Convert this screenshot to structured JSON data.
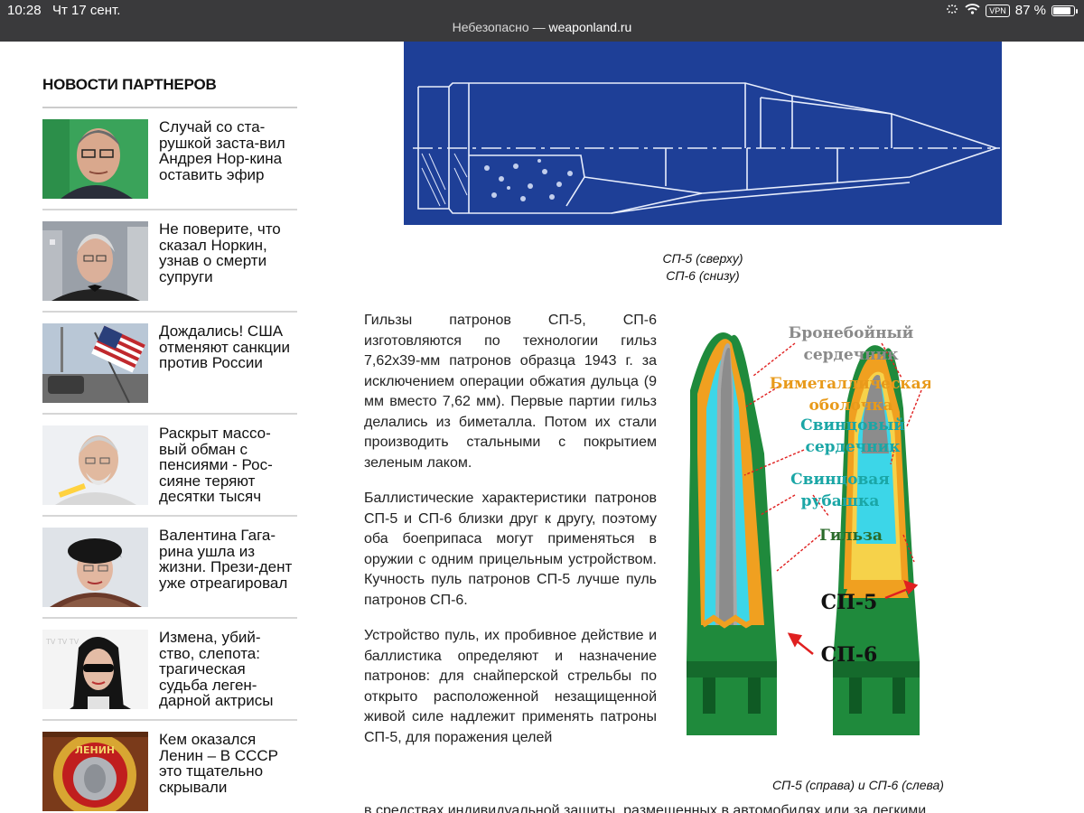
{
  "status_bar": {
    "time": "10:28",
    "date": "Чт 17 сент.",
    "vpn": "VPN",
    "battery": "87 %",
    "battery_level": 0.87
  },
  "url_bar": {
    "prefix": "Небезопасно — ",
    "host": "weaponland.ru"
  },
  "sidebar": {
    "heading": "НОВОСТИ ПАРТНЕРОВ",
    "items": [
      {
        "text": "Случай со ста-рушкой заста-вил Андрея Нор-кина оставить эфир"
      },
      {
        "text": "Не поверите, что сказал Норкин, узнав о смерти супруги"
      },
      {
        "text": "Дождались! США отменяют санкции против России"
      },
      {
        "text": "Раскрыт массо-вый обман с пенсиями - Рос-сияне теряют десятки тысяч"
      },
      {
        "text": "Валентина Гага-рина ушла из жизни. Прези-дент уже отреагировал"
      },
      {
        "text": "Измена, убий-ство, слепота: трагическая судьба леген-дарной актрисы"
      },
      {
        "text": "Кем оказался Ленин – В СССР это тщательно скрывали"
      }
    ],
    "medal_text": "ЛЕНИН"
  },
  "article": {
    "figure1_caption_line1": "СП-5 (сверху)",
    "figure1_caption_line2": "СП-6 (снизу)",
    "paragraphs": [
      "Гильзы патронов СП-5, СП-6 изготовляются по технологии гильз 7,62х39-мм патронов образца 1943 г. за исключением операции обжатия дульца (9 мм вместо 7,62 мм). Первые партии гильз делались из биметалла. Потом их стали производить стальными с покрытием зеленым лаком.",
      "Баллистические характеристики патронов СП-5 и СП-6 близки друг к другу, поэтому оба боеприпаса могут применяться в оружии с одним прицельным устройством. Кучность пуль патронов СП-5 лучше пуль патронов СП-6.",
      "Устройство пуль, их пробивное действие и баллистика определяют и назначение патронов: для снайперской стрельбы по открыто расположенной незащищенной живой силе надлежит применять патроны СП-5, для поражения целей"
    ],
    "overflow_line": "в средствах индивидуальной защиты, размещенных в автомобилях или за легкими",
    "figure2": {
      "labels": {
        "armor_core": [
          "Бронебойный",
          "сердечник"
        ],
        "bimetal_jacket": [
          "Биметаллическая",
          "оболочка"
        ],
        "lead_core": [
          "Свинцовый",
          "сердечник"
        ],
        "lead_jacket": [
          "Свинцовая",
          "рубашка"
        ],
        "case": "Гильза",
        "sp5": "СП-5",
        "sp6": "СП-6"
      },
      "colors": {
        "case_green": "#1f8a3c",
        "jacket_orange": "#f0a020",
        "core_gray": "#8c8c8c",
        "lead_cyan": "#3cd6e8",
        "label_gray": "#8a8a8a",
        "label_orange": "#e89a1a",
        "label_teal": "#1aa6a6",
        "label_green": "#2a6a2a",
        "arrow_red": "#e02020"
      }
    },
    "figure2_caption": "СП-5 (справа) и СП-6 (слева)"
  }
}
